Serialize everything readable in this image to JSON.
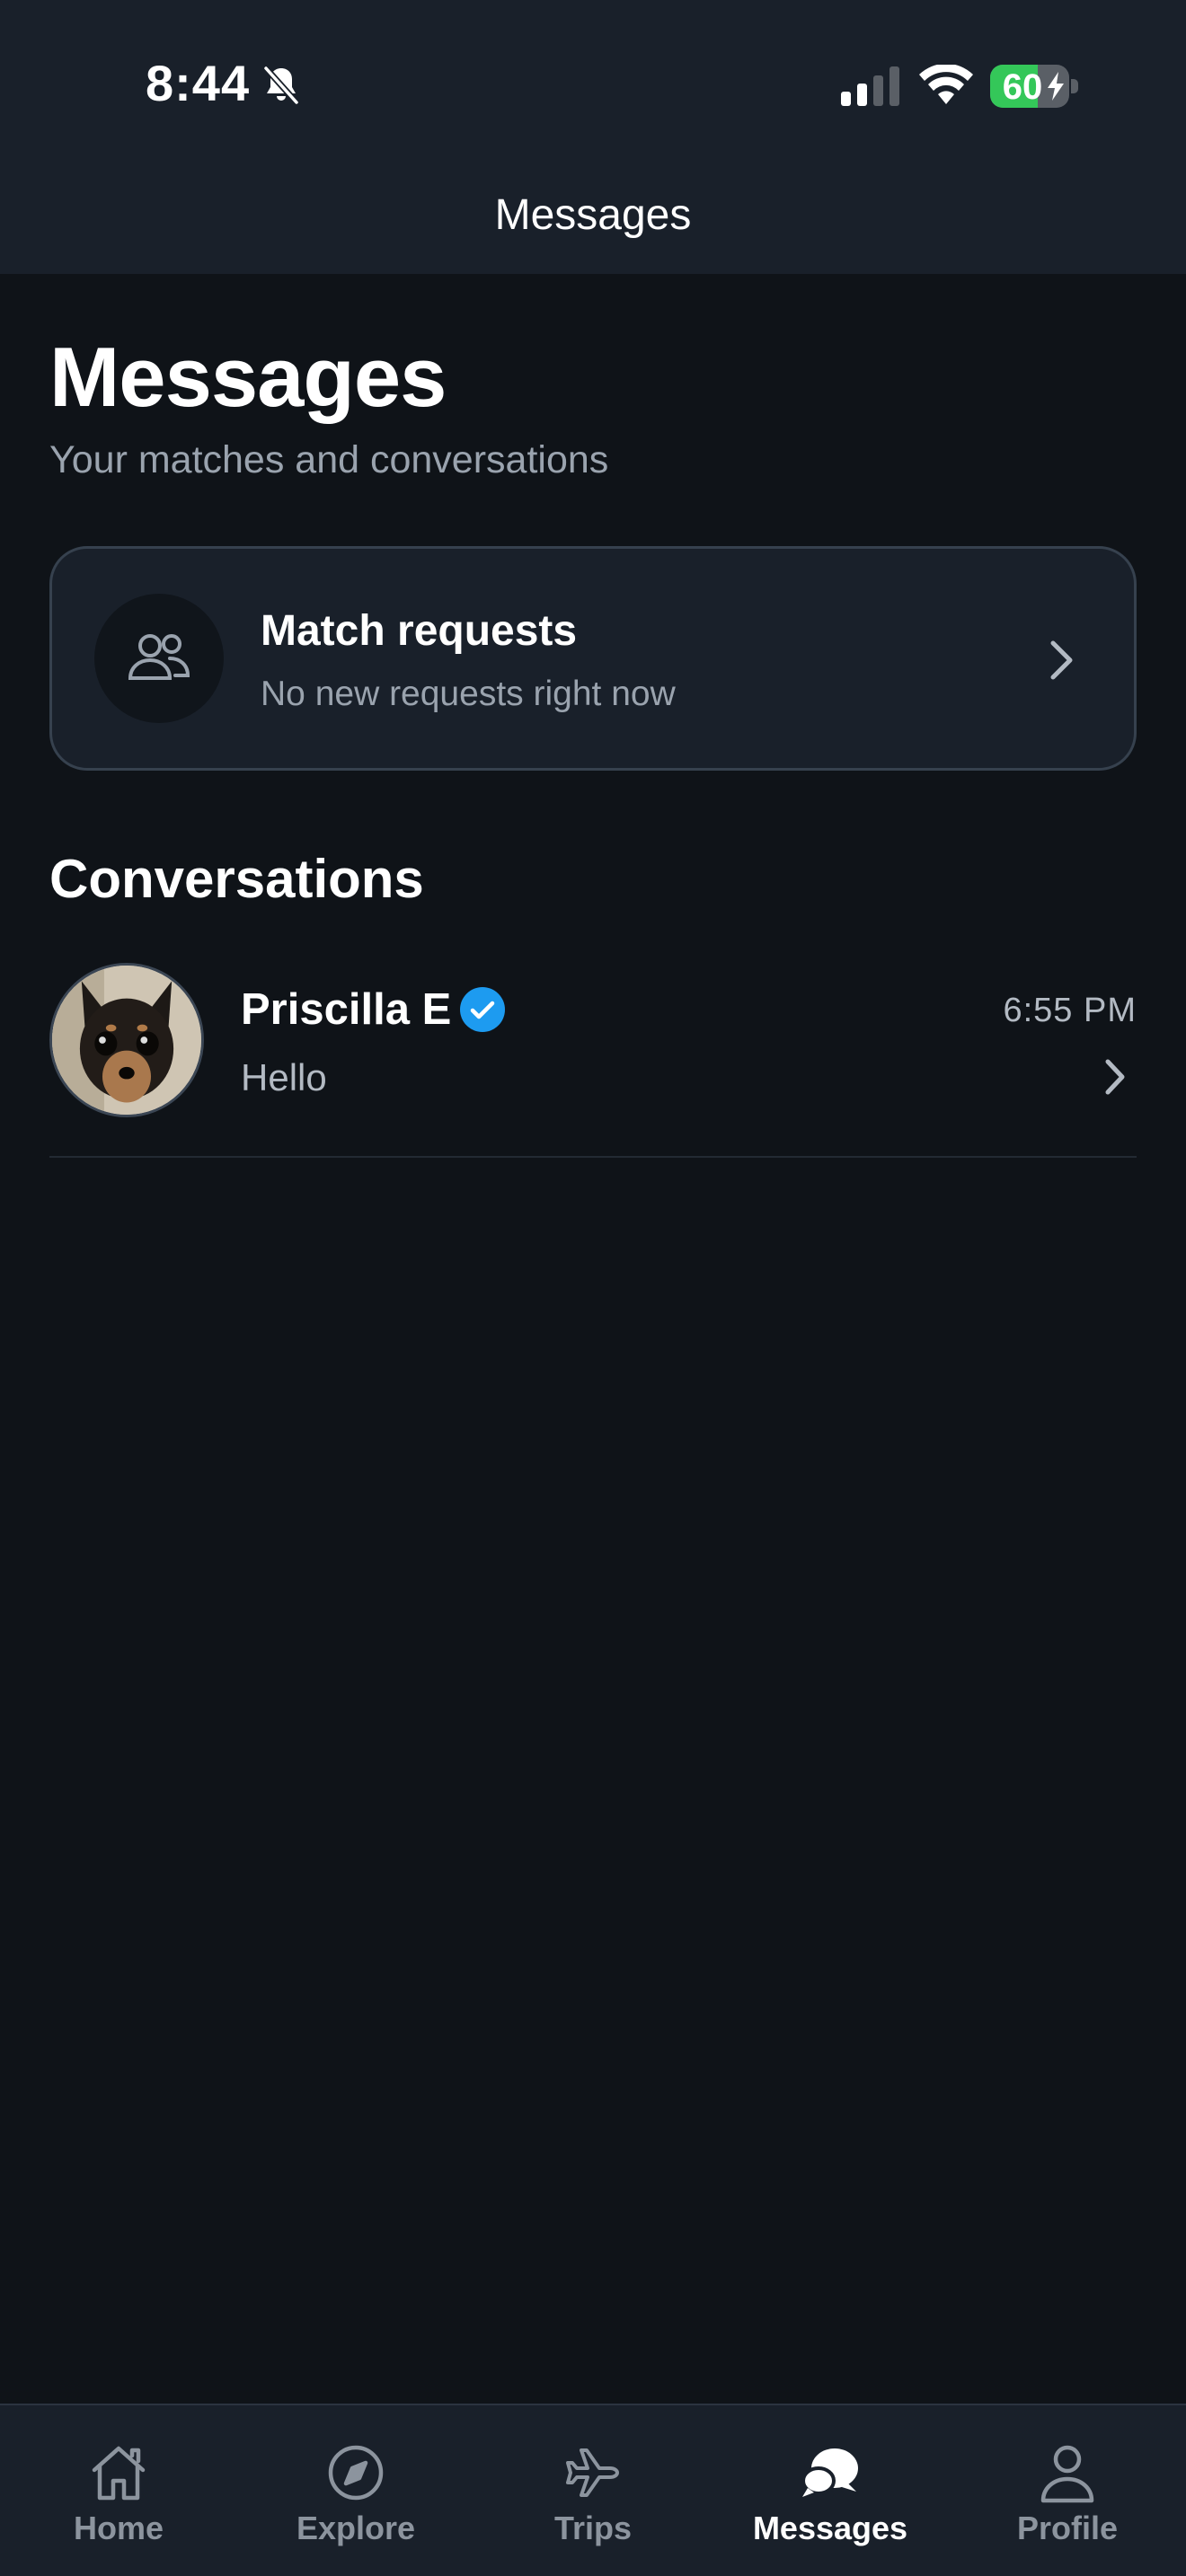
{
  "status_bar": {
    "time": "8:44",
    "battery_percent": "60",
    "battery_level": 0.6,
    "icons": [
      "bell-slash-icon",
      "signal-icon",
      "wifi-icon",
      "battery-charging-icon"
    ]
  },
  "header": {
    "title": "Messages"
  },
  "page": {
    "title": "Messages",
    "subtitle": "Your matches and conversations"
  },
  "match_requests": {
    "title": "Match requests",
    "subtitle": "No new requests right now",
    "icon": "people-icon"
  },
  "conversations": {
    "section_title": "Conversations",
    "items": [
      {
        "name": "Priscilla E",
        "verified": true,
        "preview": "Hello",
        "time": "6:55 PM"
      }
    ]
  },
  "tabbar": {
    "active": "Messages",
    "tabs": [
      {
        "label": "Home",
        "icon": "home-icon"
      },
      {
        "label": "Explore",
        "icon": "compass-icon"
      },
      {
        "label": "Trips",
        "icon": "airplane-icon"
      },
      {
        "label": "Messages",
        "icon": "chat-bubbles-icon"
      },
      {
        "label": "Profile",
        "icon": "person-icon"
      }
    ]
  },
  "colors": {
    "background": "#0f1318",
    "surface": "#19202a",
    "accent_blue": "#1d9bf0",
    "battery_green": "#34c759",
    "muted_text": "#9aa3ae"
  }
}
